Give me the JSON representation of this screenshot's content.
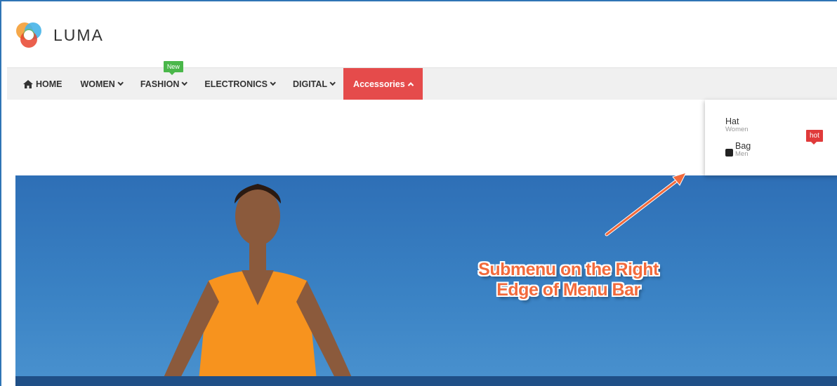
{
  "brand": {
    "name": "LUMA"
  },
  "menu": {
    "items": [
      {
        "label": "HOME",
        "icon": "home-icon"
      },
      {
        "label": "WOMEN",
        "icon": "chevron-down-icon"
      },
      {
        "label": "FASHION",
        "icon": "chevron-down-icon",
        "badge": "New"
      },
      {
        "label": "ELECTRONICS",
        "icon": "chevron-down-icon"
      },
      {
        "label": "DIGITAL",
        "icon": "chevron-down-icon"
      },
      {
        "label": "Accessories",
        "icon": "chevron-up-icon",
        "active": true
      }
    ]
  },
  "submenu": {
    "items": [
      {
        "title": "Hat",
        "subtitle": "Women"
      },
      {
        "title": "Bag",
        "subtitle": "Men",
        "icon": "user-icon"
      }
    ],
    "badge": "hot"
  },
  "annotation": {
    "line1": "Submenu on the Right",
    "line2": "Edge of Menu Bar"
  },
  "colors": {
    "active_menu": "#e54b4b",
    "new_badge": "#4ab74a",
    "hot_badge": "#e03a3a",
    "annotation": "#f26a3c",
    "frame_border": "#2f74b5"
  }
}
